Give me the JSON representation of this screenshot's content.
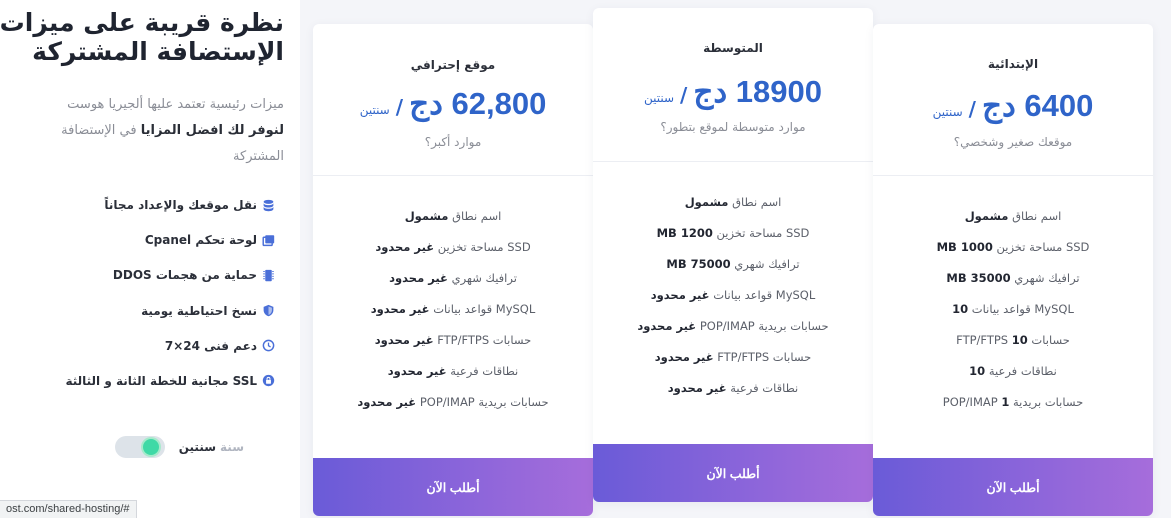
{
  "intro": {
    "title": "نظرة قريبة على ميزات الإستضافة المشتركة",
    "desc_part1": "ميزات رئيسية تعتمد عليها ألجيريا هوست",
    "desc_bold": "لنوفر لك افضل المزايا",
    "desc_part2": "في الإستضافة المشتركة"
  },
  "features": [
    {
      "label": "نقل موقعك والإعداد مجاناً",
      "icon": "database-icon"
    },
    {
      "label": "لوحة تحكم Cpanel",
      "icon": "window-icon"
    },
    {
      "label": "حماية من هجمات DDOS",
      "icon": "chip-icon"
    },
    {
      "label": "نسخ احتياطية يومية",
      "icon": "shield-icon"
    },
    {
      "label": "دعم فنى 24×7",
      "icon": "clock-icon"
    },
    {
      "label": "SSL مجانية للخطة الثانة و الثالثة",
      "icon": "lock-icon"
    }
  ],
  "billing": {
    "year_label": "سنة",
    "two_years_label": "سنتين"
  },
  "plans": {
    "basic": {
      "name": "الإبتدائية",
      "price": "6400 دج",
      "slash": "/",
      "period": "سنتين",
      "note": "موقعك صغير وشخصي؟",
      "specs": [
        {
          "pre": "اسم نطاق",
          "bold": "مشمول",
          "post": ""
        },
        {
          "pre": "SSD مساحة تخزين",
          "bold": "1000 MB",
          "post": ""
        },
        {
          "pre": "ترافيك شهري",
          "bold": "35000 MB",
          "post": ""
        },
        {
          "pre": "MySQL قواعد بيانات",
          "bold": "10",
          "post": ""
        },
        {
          "pre": "حسابات",
          "bold": "10",
          "post": "FTP/FTPS"
        },
        {
          "pre": "نطاقات فرعية",
          "bold": "10",
          "post": ""
        },
        {
          "pre": "حسابات بريدية",
          "bold": "1",
          "post": "POP/IMAP"
        }
      ],
      "cta": "أطلب الآن"
    },
    "medium": {
      "name": "المتوسطة",
      "price": "18900 دج",
      "slash": "/",
      "period": "سنتين",
      "note": "موارد متوسطة لموقع بتطور؟",
      "specs": [
        {
          "pre": "اسم نطاق",
          "bold": "مشمول",
          "post": ""
        },
        {
          "pre": "SSD مساحة تخزين",
          "bold": "1200 MB",
          "post": ""
        },
        {
          "pre": "ترافيك شهري",
          "bold": "75000 MB",
          "post": ""
        },
        {
          "pre": "MySQL قواعد بيانات",
          "bold": "غير محدود",
          "post": ""
        },
        {
          "pre": "حسابات بريدية POP/IMAP",
          "bold": "غير محدود",
          "post": ""
        },
        {
          "pre": "حسابات FTP/FTPS",
          "bold": "غير محدود",
          "post": ""
        },
        {
          "pre": "نطاقات فرعية",
          "bold": "غير محدود",
          "post": ""
        }
      ],
      "cta": "أطلب الآن"
    },
    "pro": {
      "name": "موقع إحترافي",
      "price": "62,800 دج",
      "slash": "/",
      "period": "سنتين",
      "note": "موارد أكبر؟",
      "specs": [
        {
          "pre": "اسم نطاق",
          "bold": "مشمول",
          "post": ""
        },
        {
          "pre": "SSD مساحة تخزين",
          "bold": "غير محدود",
          "post": ""
        },
        {
          "pre": "ترافيك شهري",
          "bold": "غير محدود",
          "post": ""
        },
        {
          "pre": "MySQL قواعد بيانات",
          "bold": "غير محدود",
          "post": ""
        },
        {
          "pre": "حسابات FTP/FTPS",
          "bold": "غير محدود",
          "post": ""
        },
        {
          "pre": "نطاقات فرعية",
          "bold": "غير محدود",
          "post": ""
        },
        {
          "pre": "حسابات بريدية POP/IMAP",
          "bold": "غير محدود",
          "post": ""
        }
      ],
      "cta": "أطلب الآن"
    }
  },
  "status_url": "ost.com/shared-hosting/#"
}
